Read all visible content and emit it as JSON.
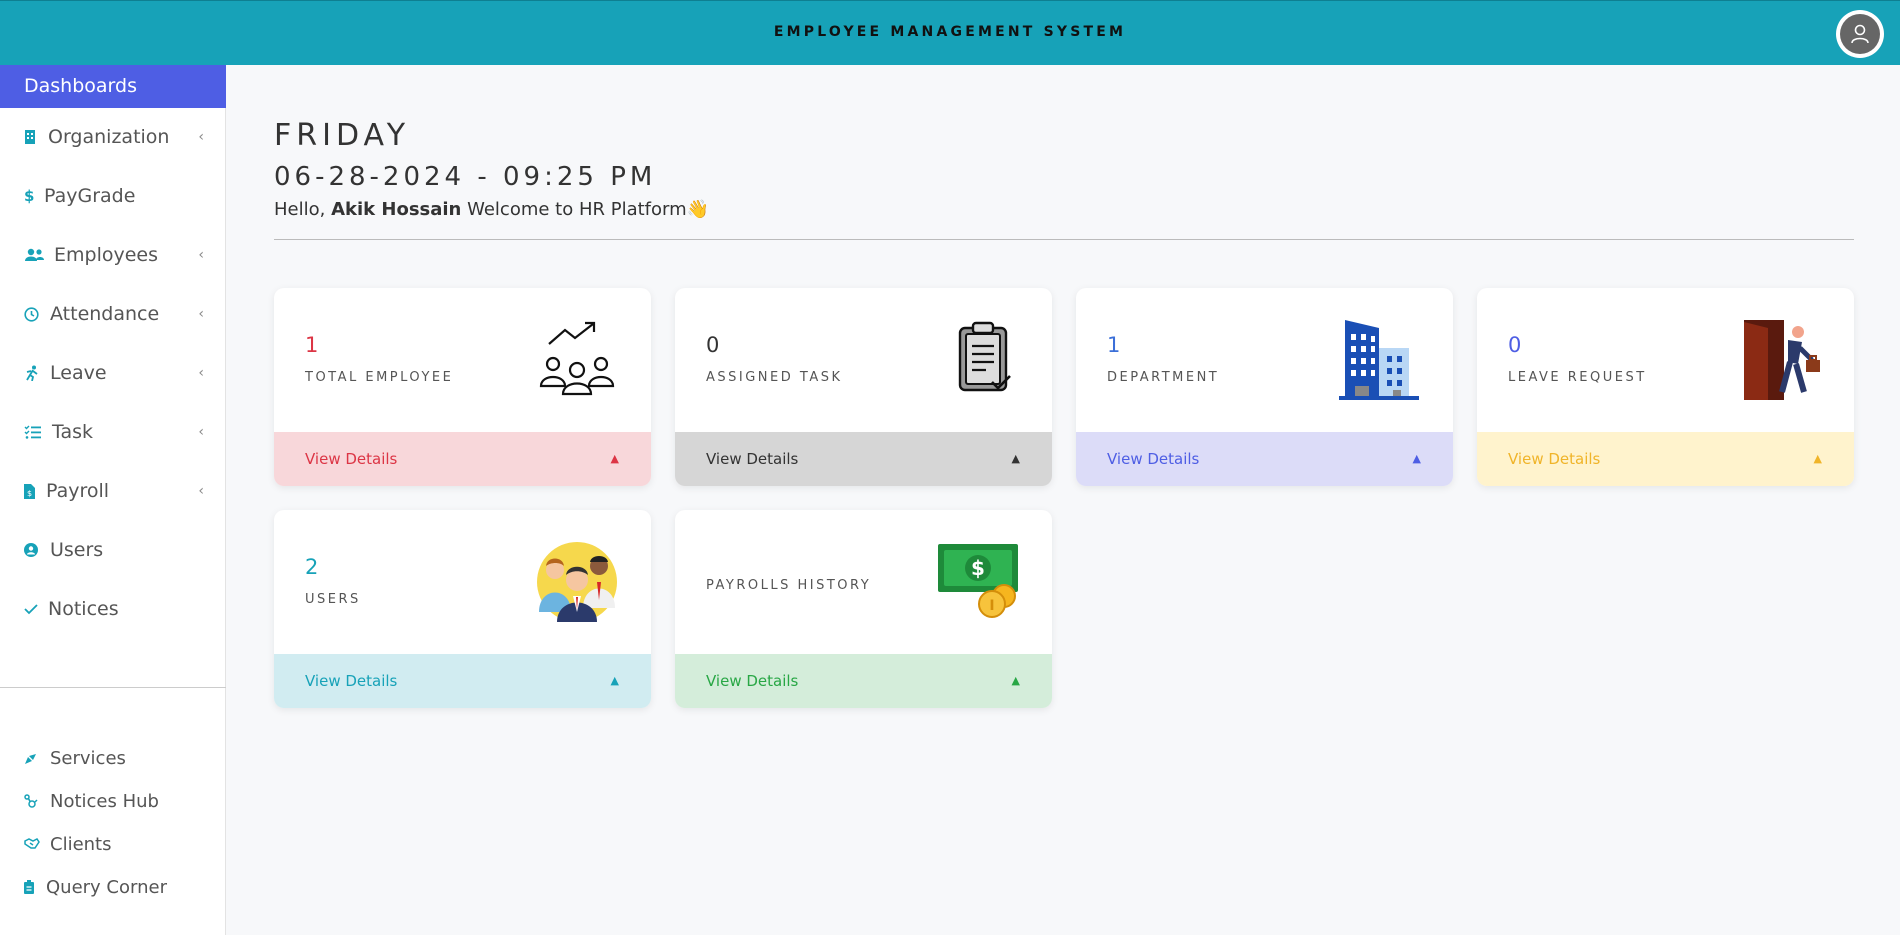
{
  "header": {
    "title": "EMPLOYEE MANAGEMENT SYSTEM"
  },
  "sidebar": {
    "active": "Dashboards",
    "items": [
      {
        "label": "Organization",
        "icon": "building-icon",
        "submenu": true
      },
      {
        "label": "PayGrade",
        "icon": "dollar-icon",
        "submenu": false
      },
      {
        "label": "Employees",
        "icon": "users-icon",
        "submenu": true
      },
      {
        "label": "Attendance",
        "icon": "clock-icon",
        "submenu": true
      },
      {
        "label": "Leave",
        "icon": "running-person-icon",
        "submenu": true
      },
      {
        "label": "Task",
        "icon": "checklist-icon",
        "submenu": true
      },
      {
        "label": "Payroll",
        "icon": "file-dollar-icon",
        "submenu": true
      },
      {
        "label": "Users",
        "icon": "user-circle-icon",
        "submenu": false
      },
      {
        "label": "Notices",
        "icon": "check-icon",
        "submenu": false
      }
    ],
    "bottom_items": [
      {
        "label": "Services",
        "icon": "pen-icon"
      },
      {
        "label": "Notices Hub",
        "icon": "hub-icon"
      },
      {
        "label": "Clients",
        "icon": "handshake-icon"
      },
      {
        "label": "Query Corner",
        "icon": "clipboard-icon"
      }
    ],
    "chevron": "‹"
  },
  "main": {
    "day": "FRIDAY",
    "datetime": "06-28-2024 - 09:25 PM",
    "greeting_prefix": "Hello, ",
    "user_name": "Akik Hossain",
    "greeting_suffix": " Welcome to HR Platform",
    "wave": "👋"
  },
  "cards": [
    {
      "value": "1",
      "label": "TOTAL EMPLOYEE",
      "link": "View Details",
      "icon": "team-growth-icon",
      "accent": "#dc3545",
      "footer_bg": "#f8d7da"
    },
    {
      "value": "0",
      "label": "ASSIGNED TASK",
      "link": "View Details",
      "icon": "clipboard-check-icon",
      "accent": "#333333",
      "footer_bg": "#d6d6d6"
    },
    {
      "value": "1",
      "label": "DEPARTMENT",
      "link": "View Details",
      "icon": "office-building-icon",
      "accent": "#3b6fd8",
      "footer_bg": "#dcdcf8"
    },
    {
      "value": "0",
      "label": "LEAVE REQUEST",
      "link": "View Details",
      "icon": "exit-door-icon",
      "accent": "#4e5ee4",
      "footer_bg": "#fff3cd",
      "link_color": "#f0b429"
    },
    {
      "value": "2",
      "label": "USERS",
      "link": "View Details",
      "icon": "people-group-icon",
      "accent": "#17a2b8",
      "footer_bg": "#d1ecf1"
    },
    {
      "value": "",
      "label": "PAYROLLS HISTORY",
      "link": "View Details",
      "icon": "money-coins-icon",
      "accent": "#28a745",
      "footer_bg": "#d4edda"
    }
  ]
}
